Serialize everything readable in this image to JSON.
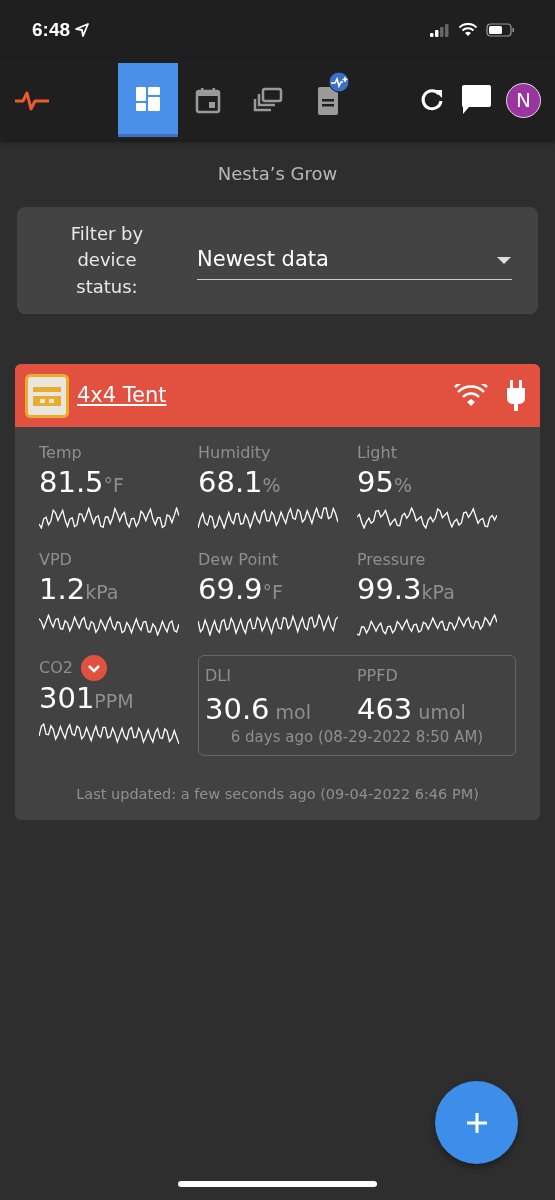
{
  "status_bar": {
    "time": "6:48"
  },
  "toolbar": {
    "tabs": [
      {
        "kind": "dashboard",
        "selected": true
      },
      {
        "kind": "calendar",
        "selected": false
      },
      {
        "kind": "gallery",
        "selected": false
      },
      {
        "kind": "report",
        "selected": false
      }
    ],
    "avatar": "N"
  },
  "title": "Nesta’s Grow",
  "filter": {
    "label": "Filter by device status:",
    "value": "Newest data"
  },
  "device": {
    "name": "4x4 Tent",
    "metrics": [
      {
        "label": "Temp",
        "value": "81.5",
        "unit": "°F"
      },
      {
        "label": "Humidity",
        "value": "68.1",
        "unit": "%"
      },
      {
        "label": "Light",
        "value": "95",
        "unit": "%"
      },
      {
        "label": "VPD",
        "value": "1.2",
        "unit": "kPa"
      },
      {
        "label": "Dew Point",
        "value": "69.9",
        "unit": "°F"
      },
      {
        "label": "Pressure",
        "value": "99.3",
        "unit": "kPa"
      },
      {
        "label": "CO2",
        "value": "301",
        "unit": "PPM",
        "alert": true
      }
    ],
    "light_box": {
      "metrics": [
        {
          "label": "DLI",
          "value": "30.6",
          "unit": "mol"
        },
        {
          "label": "PPFD",
          "value": "463",
          "unit": "umol"
        }
      ],
      "time": "6 days ago (08-29-2022 8:50 AM)"
    },
    "last_updated": "Last updated: a few seconds ago (09-04-2022 6:46 PM)"
  }
}
